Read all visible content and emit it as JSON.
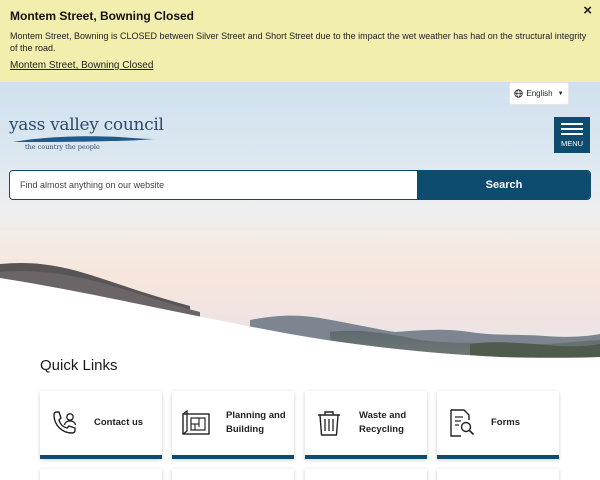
{
  "alert": {
    "title": "Montem Street, Bowning Closed",
    "body": "Montem Street, Bowning is CLOSED between Silver Street and Short Street due to the impact the wet weather has had on the structural integrity of the road.",
    "link": "Montem Street, Bowning Closed",
    "close": "×"
  },
  "header": {
    "language": "English",
    "logo_name": "yass valley council",
    "logo_tagline": "the country    the people",
    "menu_label": "MENU"
  },
  "search": {
    "placeholder": "Find almost anything on our website",
    "button": "Search"
  },
  "quick_links": {
    "heading": "Quick Links",
    "items": [
      {
        "label": "Contact us",
        "icon": "phone-contact-icon"
      },
      {
        "label": "Planning and Building",
        "icon": "blueprint-icon"
      },
      {
        "label": "Waste and Recycling",
        "icon": "bin-icon"
      },
      {
        "label": "Forms",
        "icon": "document-search-icon"
      }
    ]
  },
  "colors": {
    "primary": "#0e4c6f",
    "alert_bg": "#f2eeae"
  }
}
